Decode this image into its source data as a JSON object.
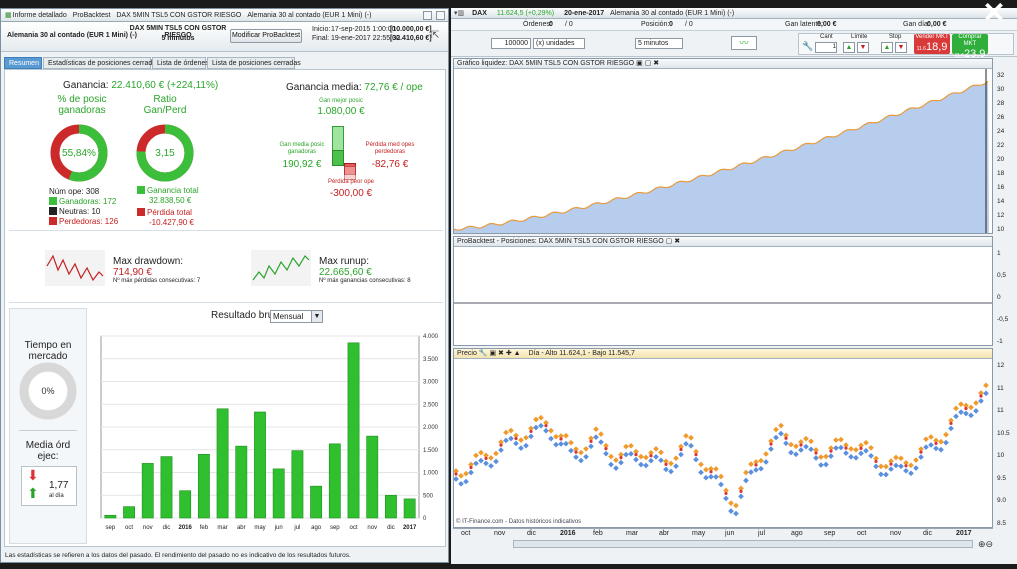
{
  "left_window": {
    "title_items": [
      "Informe detallado",
      "ProBacktest",
      "DAX 5MIN TSL5 CON GSTOR RIESGO",
      "Alemania 30 al contado (EUR 1 Mini) (-)"
    ],
    "instrument": "Alemania 30 al contado (EUR 1 Mini) (-)",
    "strategy_name": "DAX 5MIN TSL5 CON GSTOR RIESGO",
    "timeframe": "5 minutos",
    "modify_button": "Modificar ProBacktest",
    "start_label": "Inicio:",
    "start_date": "17-sep-2015 1:00:00",
    "start_value": "[10.000,00 €]",
    "end_label": "Final:",
    "end_date": "19-ene-2017 22:55:00",
    "end_value": "[32.410,60 €]",
    "tabs": [
      "Resumen",
      "Estadísticas de posiciones cerradas",
      "Lista de órdenes",
      "Lista de posiciones cerradas"
    ],
    "gain_label": "Ganancia:",
    "gain_value": "22.410,60 € (+224,11%)",
    "winning_pct_label": "% de posic ganadoras",
    "winning_pct_value": "55,84%",
    "winning_pct_fraction": 0.5584,
    "ratio_label": "Ratio Gan/Perd",
    "ratio_value": "3,15",
    "ratio_fraction": 0.759,
    "num_ops": "Núm ope: 308",
    "winners": "Ganadoras: 172",
    "neutral": "Neutras: 10",
    "losers": "Perdedoras: 126",
    "total_gain_label": "Ganancia total",
    "total_gain_value": "32.838,50 €",
    "total_loss_label": "Pérdida total",
    "total_loss_value": "-10.427,90 €",
    "avg_gain_label": "Ganancia media:",
    "avg_gain_value": "72,76 € / ope",
    "best_label": "Gan mejor posic",
    "best_value": "1.080,00 €",
    "avg_win_label": "Gan media posic ganadoras",
    "avg_win_value": "190,92 €",
    "avg_loss_label": "Pérdida med opes perdedoras",
    "avg_loss_value": "-82,76 €",
    "worst_label": "Pérdida peor ope",
    "worst_value": "-300,00 €",
    "max_dd_label": "Max drawdown:",
    "max_dd_value": "714,90 €",
    "max_losses": "Nº máx pérdidas consecutivas: 7",
    "max_runup_label": "Max runup:",
    "max_runup_value": "22.665,60 €",
    "max_wins": "Nº máx ganancias consecutivas: 8",
    "time_market_label": "Tiempo en mercado",
    "time_market_value": "0%",
    "avg_orders_label": "Media órd ejec:",
    "avg_orders_value": "1,77",
    "avg_orders_unit": "al día",
    "result_label": "Resultado bruto",
    "period_select": "Mensual",
    "footer": "Las estadísticas se refieren a los datos del pasado. El rendimiento del pasado no es indicativo de los resultados futuros."
  },
  "chart_data": {
    "type": "bar",
    "categories": [
      "sep",
      "oct",
      "nov",
      "dic",
      "2016",
      "feb",
      "mar",
      "abr",
      "may",
      "jun",
      "jul",
      "ago",
      "sep",
      "oct",
      "nov",
      "dic",
      "2017"
    ],
    "values": [
      60,
      250,
      1200,
      1350,
      600,
      1400,
      2400,
      1580,
      2330,
      1080,
      1480,
      700,
      1630,
      3850,
      1800,
      500,
      420
    ],
    "ylim": [
      0,
      4000
    ],
    "yticks": [
      "0",
      "500",
      "1.000",
      "1.500",
      "2.000",
      "2.500",
      "3.000",
      "3.500",
      "4.000"
    ],
    "color": "#2fbf2f"
  },
  "right_window": {
    "title": "DAX",
    "title_price": "11.624,5 (+0,29%)",
    "title_date": "20-ene-2017",
    "title_instrument": "Alemania 30 al contado (EUR 1 Mini) (-)",
    "orders_label": "Órdenes:",
    "orders_value": "0",
    "orders_ratio": "/ 0",
    "position_label": "Posición:",
    "position_value": "0",
    "position_ratio": "/ 0",
    "latent_label": "Gan latente:",
    "latent_value": "0,00 €",
    "day_label": "Gan día:",
    "day_value": "0,00 €",
    "qty_value": "100000",
    "units_select": "(x) unidades",
    "interval_select": "5 minutos",
    "cant_label": "Cant",
    "cant_value": "1",
    "limit_label": "Límite",
    "stop_label": "Stop",
    "sell_label": "Vender MKT",
    "sell_small": "11.6",
    "sell_big": "18,9",
    "buy_label": "Comprar MKT",
    "buy_small": "11.6",
    "buy_big": "23,9",
    "panel1_title": "Gráfico liquidez: DAX 5MIN TSL5 CON GSTOR RIESGO",
    "panel1_axis": [
      "32",
      "30",
      "28",
      "26",
      "24",
      "22",
      "20",
      "18",
      "16",
      "14",
      "12",
      "10"
    ],
    "panel2_title": "ProBacktest - Posiciones: DAX 5MIN TSL5 CON GSTOR RIESGO",
    "panel2_axis": [
      "1",
      "0,5",
      "0",
      "-0,5",
      "-1"
    ],
    "panel3_title": "Precio",
    "panel3_info": "Día - Alto 11.624,1 - Bajo 11.545,7",
    "panel3_axis": [
      "12",
      "11",
      "11",
      "10.5",
      "10",
      "9.5",
      "9.0",
      "8.5"
    ],
    "panel3_footer": "© IT-Finance.com - Datos históricos indicativos",
    "time_axis": [
      "oct",
      "nov",
      "dic",
      "2016",
      "feb",
      "mar",
      "abr",
      "may",
      "jun",
      "jul",
      "ago",
      "sep",
      "oct",
      "nov",
      "dic",
      "2017"
    ]
  },
  "colors": {
    "accent": "#5a9ad3",
    "gain": "#2aa52a",
    "loss": "#c42020",
    "equity_fill": "#b7cdee"
  }
}
